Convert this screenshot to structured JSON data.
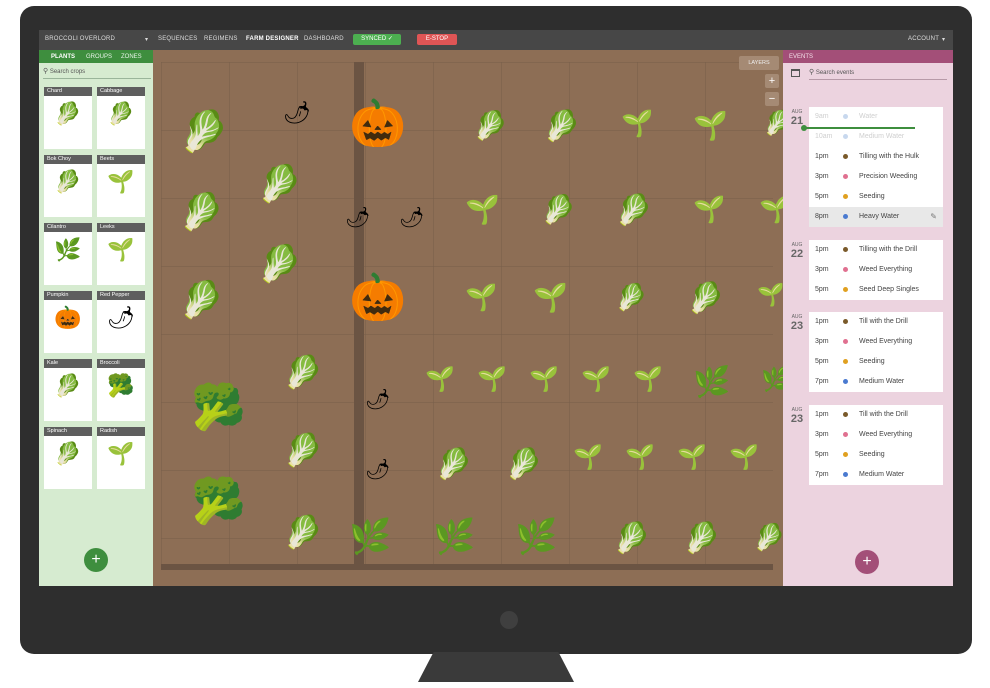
{
  "nav": {
    "brand": "BROCCOLI OVERLORD",
    "links": [
      "SEQUENCES",
      "REGIMENS",
      "FARM DESIGNER",
      "DASHBOARD"
    ],
    "synced": "SYNCED ✓",
    "estop": "E-STOP",
    "account": "ACCOUNT"
  },
  "left": {
    "tabs": [
      "PLANTS",
      "GROUPS",
      "ZONES"
    ],
    "search_placeholder": "Search crops",
    "crops": [
      {
        "name": "Chard",
        "icon": "chard-icon",
        "glyph": "🥬"
      },
      {
        "name": "Cabbage",
        "icon": "cabbage-icon",
        "glyph": "🥬"
      },
      {
        "name": "Bok Choy",
        "icon": "bok-choy-icon",
        "glyph": "🥬"
      },
      {
        "name": "Beets",
        "icon": "beet-icon",
        "glyph": "🌱"
      },
      {
        "name": "Cilantro",
        "icon": "cilantro-icon",
        "glyph": "🌿"
      },
      {
        "name": "Leeks",
        "icon": "leek-icon",
        "glyph": "🌱"
      },
      {
        "name": "Pumpkin",
        "icon": "pumpkin-icon",
        "glyph": "🎃"
      },
      {
        "name": "Red Pepper",
        "icon": "red-pepper-icon",
        "glyph": "🌶"
      },
      {
        "name": "Kale",
        "icon": "kale-icon",
        "glyph": "🥬"
      },
      {
        "name": "Broccoli",
        "icon": "broccoli-icon",
        "glyph": "🥦"
      },
      {
        "name": "Spinach",
        "icon": "spinach-icon",
        "glyph": "🥬"
      },
      {
        "name": "Radish",
        "icon": "radish-icon",
        "glyph": "🌱"
      }
    ],
    "add": "+"
  },
  "map": {
    "layers": "LAYERS",
    "zoom_in": "+",
    "zoom_out": "−"
  },
  "events": {
    "title": "EVENTS",
    "search_placeholder": "Search events",
    "add": "+",
    "days": [
      {
        "month": "AUG",
        "day": "21",
        "items": [
          {
            "time": "9am",
            "name": "Water",
            "dot": "#7aa0d8",
            "past": true
          },
          {
            "time": "10am",
            "name": "Medium Water",
            "dot": "#7aa0d8",
            "past": true
          },
          {
            "time": "1pm",
            "name": "Tilling with the Hulk",
            "dot": "#7a5a2a"
          },
          {
            "time": "3pm",
            "name": "Precision Weeding",
            "dot": "#e07090"
          },
          {
            "time": "5pm",
            "name": "Seeding",
            "dot": "#e0a020"
          },
          {
            "time": "8pm",
            "name": "Heavy Water",
            "dot": "#4a7ad0",
            "hl": true
          }
        ]
      },
      {
        "month": "AUG",
        "day": "22",
        "items": [
          {
            "time": "1pm",
            "name": "Tilling with the Drill",
            "dot": "#7a5a2a"
          },
          {
            "time": "3pm",
            "name": "Weed Everything",
            "dot": "#e07090"
          },
          {
            "time": "5pm",
            "name": "Seed Deep Singles",
            "dot": "#e0a020"
          }
        ]
      },
      {
        "month": "AUG",
        "day": "23",
        "items": [
          {
            "time": "1pm",
            "name": "Till with the Drill",
            "dot": "#7a5a2a"
          },
          {
            "time": "3pm",
            "name": "Weed Everything",
            "dot": "#e07090"
          },
          {
            "time": "5pm",
            "name": "Seeding",
            "dot": "#e0a020"
          },
          {
            "time": "7pm",
            "name": "Medium Water",
            "dot": "#4a7ad0"
          }
        ]
      },
      {
        "month": "AUG",
        "day": "23",
        "items": [
          {
            "time": "1pm",
            "name": "Till with the Drill",
            "dot": "#7a5a2a"
          },
          {
            "time": "3pm",
            "name": "Weed Everything",
            "dot": "#e07090"
          },
          {
            "time": "5pm",
            "name": "Seeding",
            "dot": "#e0a020"
          },
          {
            "time": "7pm",
            "name": "Medium Water",
            "dot": "#4a7ad0"
          }
        ]
      }
    ]
  },
  "colors": {
    "plants_green": "#3e8e3e",
    "events_magenta": "#a34f78",
    "synced": "#4caf50",
    "estop": "#e05555"
  }
}
